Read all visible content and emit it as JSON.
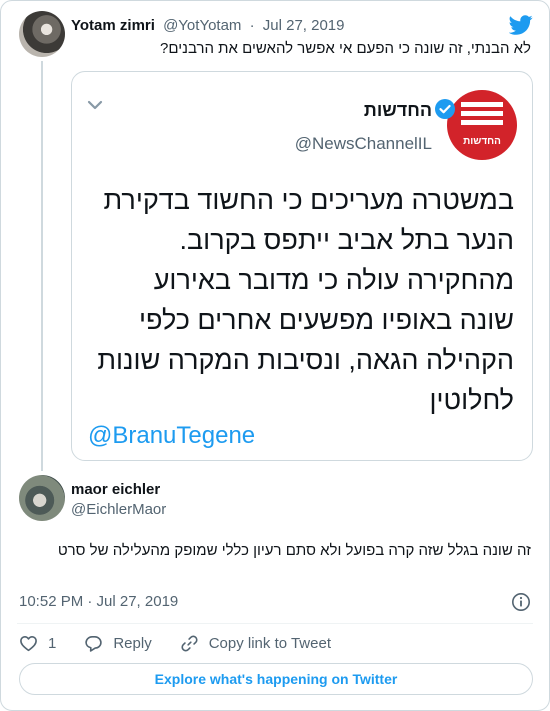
{
  "parent_tweet": {
    "author_name": "Yotam zimri",
    "handle": "@YotYotam",
    "separator": "·",
    "date": "Jul 27, 2019",
    "text": "לא הבנתי, זה שונה כי הפעם אי אפשר להאשים את הרבנים?"
  },
  "quoted_image": {
    "logo_text": "החדשות",
    "account_name": "החדשות",
    "account_handle": "@NewsChannelIL",
    "body_lines": [
      "במשטרה מעריכים כי החשוד בדקירת",
      "הנער בתל אביב ייתפס בקרוב.",
      "מהחקירה עולה כי מדובר באירוע",
      "שונה באופיו מפשעים אחרים כלפי",
      "הקהילה הגאה, ונסיבות המקרה שונות",
      "לחלוטין"
    ],
    "mention": "@BranuTegene"
  },
  "reply_tweet": {
    "author_name": "maor eichler",
    "handle": "@EichlerMaor",
    "text": "זה שונה בגלל שזה קרה בפועל ולא סתם רעיון כללי שמופק מהעלילה של סרט",
    "timestamp": "10:52 PM · Jul 27, 2019"
  },
  "actions": {
    "like_count": "1",
    "reply_label": "Reply",
    "copy_link_label": "Copy link to Tweet"
  },
  "footer": {
    "explore_label": "Explore what's happening on Twitter"
  },
  "colors": {
    "accent": "#1d9bf0",
    "logo_red": "#d2232a",
    "secondary_text": "#536471"
  }
}
